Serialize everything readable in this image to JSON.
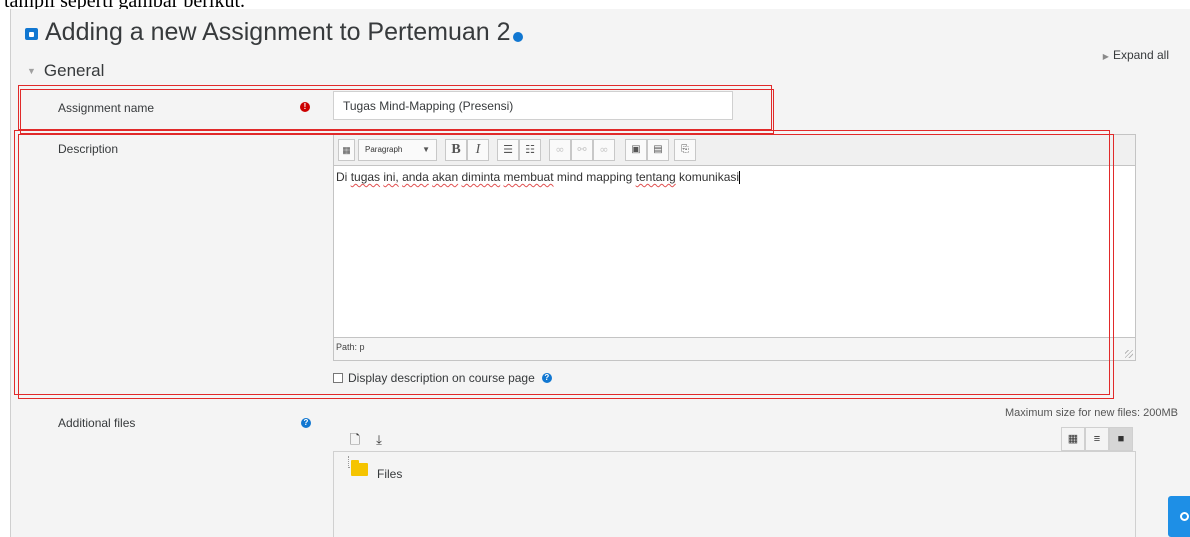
{
  "caption_fragment": "tampil seperti gambar berikut.",
  "page": {
    "title": "Adding a new Assignment to Pertemuan 2",
    "expand_all": "Expand all"
  },
  "section": {
    "title": "General"
  },
  "fields": {
    "assignment_name": {
      "label": "Assignment name",
      "value": "Tugas Mind-Mapping (Presensi)"
    },
    "description": {
      "label": "Description",
      "paragraph_select": "Paragraph",
      "content_words": [
        "Di",
        "tugas",
        "ini,",
        "anda",
        "akan",
        "diminta",
        "membuat",
        "mind",
        "mapping",
        "tentang",
        "komunikasi"
      ],
      "path": "Path: p"
    },
    "display_description": {
      "label": "Display description on course page",
      "checked": false
    },
    "additional_files": {
      "label": "Additional files",
      "max_size": "Maximum size for new files: 200MB",
      "folder": "Files"
    }
  },
  "toolbar_icons": [
    "toggle-toolbar-icon",
    "bold-icon",
    "italic-icon",
    "unordered-list-icon",
    "ordered-list-icon",
    "link-icon",
    "unlink-icon",
    "anchor-icon",
    "image-icon",
    "media-icon",
    "paste-icon"
  ],
  "colors": {
    "accent": "#1177d1",
    "required": "#cc0000",
    "annotation": "#e12a2a",
    "folder": "#f5c400"
  }
}
